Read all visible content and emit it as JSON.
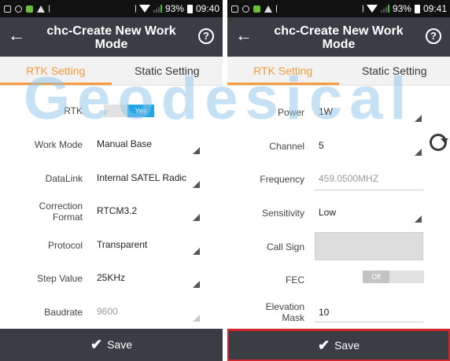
{
  "watermark": "Geodesical",
  "left": {
    "status": {
      "battery": "93%",
      "time": "09:40"
    },
    "title": "chc-Create New Work Mode",
    "tabs": [
      "RTK Setting",
      "Static Setting"
    ],
    "rows": [
      {
        "label": "RTK",
        "toggle": "Yes"
      },
      {
        "label": "Work Mode",
        "value": "Manual Base"
      },
      {
        "label": "DataLink",
        "value": "Internal SATEL Radic"
      },
      {
        "label": "Correction Format",
        "value": "RTCM3.2"
      },
      {
        "label": "Protocol",
        "value": "Transparent"
      },
      {
        "label": "Step Value",
        "value": "25KHz"
      },
      {
        "label": "Baudrate",
        "value": "9600"
      }
    ],
    "save": "Save"
  },
  "right": {
    "status": {
      "battery": "93%",
      "time": "09:41"
    },
    "title": "chc-Create New Work Mode",
    "tabs": [
      "RTK Setting",
      "Static Setting"
    ],
    "rows": [
      {
        "label": "Power",
        "value": "1W"
      },
      {
        "label": "Channel",
        "value": "5"
      },
      {
        "label": "Frequency",
        "value": "459.0500MHZ"
      },
      {
        "label": "Sensitivity",
        "value": "Low"
      },
      {
        "label": "Call Sign",
        "value": ""
      },
      {
        "label": "FEC",
        "toggle": "Off"
      },
      {
        "label": "Elevation Mask",
        "value": "10"
      }
    ],
    "save": "Save"
  },
  "colors": {
    "accent": "#f59b3c",
    "toggle_on": "#22a6e6",
    "header": "#3a3d43",
    "highlight": "#d0262e"
  },
  "icons": [
    "back-arrow-icon",
    "help-icon",
    "refresh-icon",
    "check-icon",
    "wifi-icon",
    "signal-icon",
    "battery-icon"
  ]
}
